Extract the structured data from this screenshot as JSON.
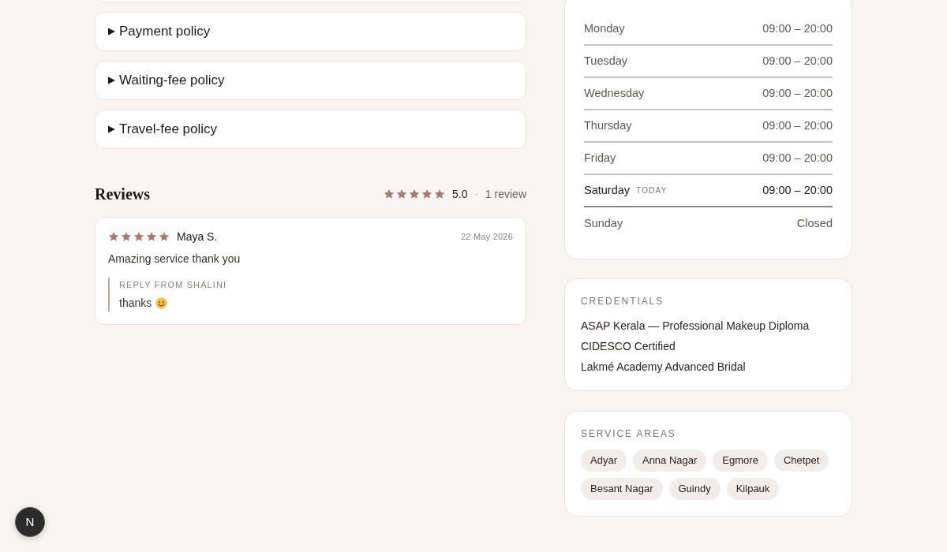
{
  "policies": [
    {
      "label": "Payment policy",
      "expanded": false
    },
    {
      "label": "Waiting-fee policy",
      "expanded": false
    },
    {
      "label": "Travel-fee policy",
      "expanded": false
    }
  ],
  "reviews_section": {
    "title": "Reviews",
    "stars": 5,
    "rating": "5.0",
    "separator": "·",
    "count": "1 review"
  },
  "reviews": [
    {
      "stars": 5,
      "author": "Maya S.",
      "date": "22 May 2026",
      "text": "Amazing service thank you",
      "reply": {
        "label": "REPLY FROM SHALINI",
        "text": "thanks"
      }
    }
  ],
  "hours": [
    {
      "day": "Monday",
      "time": "09:00 – 20:00",
      "today": false
    },
    {
      "day": "Tuesday",
      "time": "09:00 – 20:00",
      "today": false
    },
    {
      "day": "Wednesday",
      "time": "09:00 – 20:00",
      "today": false
    },
    {
      "day": "Thursday",
      "time": "09:00 – 20:00",
      "today": false
    },
    {
      "day": "Friday",
      "time": "09:00 – 20:00",
      "today": false
    },
    {
      "day": "Saturday",
      "time": "09:00 – 20:00",
      "today": true,
      "badge": "TODAY"
    },
    {
      "day": "Sunday",
      "time": "Closed",
      "today": false
    }
  ],
  "credentials": {
    "title": "CREDENTIALS",
    "items": [
      "ASAP Kerala — Professional Makeup Diploma",
      "CIDESCO Certified",
      "Lakmé Academy Advanced Bridal"
    ]
  },
  "service_areas": {
    "title": "SERVICE AREAS",
    "items": [
      "Adyar",
      "Anna Nagar",
      "Egmore",
      "Chetpet",
      "Besant Nagar",
      "Guindy",
      "Kilpauk"
    ]
  },
  "dev_badge": {
    "label": "N"
  }
}
